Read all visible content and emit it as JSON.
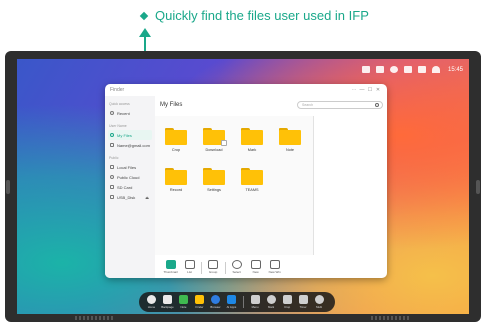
{
  "annotation": {
    "text": "Quickly find the files user used in IFP",
    "color": "#1aa88a"
  },
  "status_bar": {
    "time": "15:45",
    "icons": [
      "screen-icon",
      "volume-icon",
      "brightness-icon",
      "window-icon",
      "network-icon",
      "wifi-icon"
    ]
  },
  "finder": {
    "window_title": "Finder",
    "window_controls": [
      "⋯",
      "—",
      "☐",
      "✕"
    ],
    "sidebar": {
      "sections": [
        {
          "heading": "Quick access",
          "items": [
            {
              "label": "Recent",
              "icon": "clock-icon",
              "active": false
            }
          ]
        },
        {
          "heading": "User Name",
          "items": [
            {
              "label": "My Files",
              "icon": "user-icon",
              "active": true
            },
            {
              "label": "Name@gmail.com",
              "icon": "mail-icon",
              "active": false
            }
          ]
        },
        {
          "heading": "Public",
          "items": [
            {
              "label": "Local Files",
              "icon": "drive-icon",
              "active": false
            },
            {
              "label": "Public Cloud",
              "icon": "cloud-icon",
              "active": false
            },
            {
              "label": "SD Card",
              "icon": "sd-card-icon",
              "active": false
            },
            {
              "label": "USB_Disk",
              "icon": "usb-icon",
              "active": false
            }
          ]
        }
      ]
    },
    "main_title": "My Files",
    "search_placeholder": "Search",
    "folders": [
      {
        "label": "Crop",
        "badge": false
      },
      {
        "label": "Download",
        "badge": true
      },
      {
        "label": "Mark",
        "badge": false
      },
      {
        "label": "Note",
        "badge": false
      },
      {
        "label": "Record",
        "badge": false
      },
      {
        "label": "Settings",
        "badge": false
      },
      {
        "label": "TEAMS",
        "badge": false
      }
    ],
    "toolbar": [
      {
        "label": "Thumbnail",
        "icon": "grid-view-icon",
        "active": true
      },
      {
        "label": "List",
        "icon": "list-view-icon",
        "active": false
      },
      {
        "label": "Group",
        "icon": "group-icon",
        "active": false
      },
      {
        "label": "Select",
        "icon": "select-icon",
        "active": false
      },
      {
        "label": "New",
        "icon": "new-folder-icon",
        "active": false
      },
      {
        "label": "New Win",
        "icon": "new-window-icon",
        "active": false
      }
    ]
  },
  "dock": {
    "left": [
      {
        "label": "Home",
        "icon": "home-icon",
        "color": "#e9e9e9"
      },
      {
        "label": "Backpage",
        "icon": "back-icon",
        "color": "#e9e9e9"
      },
      {
        "label": "Note",
        "icon": "note-icon",
        "color": "#3fb950"
      },
      {
        "label": "Finder",
        "icon": "finder-icon",
        "color": "#ffc107"
      },
      {
        "label": "Browser",
        "icon": "browser-icon",
        "color": "#2f7de1"
      },
      {
        "label": "AI Apps",
        "icon": "apps-icon",
        "color": "#1e88e5"
      }
    ],
    "right": [
      {
        "label": "Menu",
        "icon": "menu-icon",
        "color": "#cfcfcf"
      },
      {
        "label": "Mark",
        "icon": "mark-icon",
        "color": "#cfcfcf"
      },
      {
        "label": "Crop",
        "icon": "crop-icon",
        "color": "#cfcfcf"
      },
      {
        "label": "Timer",
        "icon": "timer-icon",
        "color": "#cfcfcf"
      },
      {
        "label": "Multi",
        "icon": "multi-icon",
        "color": "#cfcfcf"
      }
    ]
  }
}
